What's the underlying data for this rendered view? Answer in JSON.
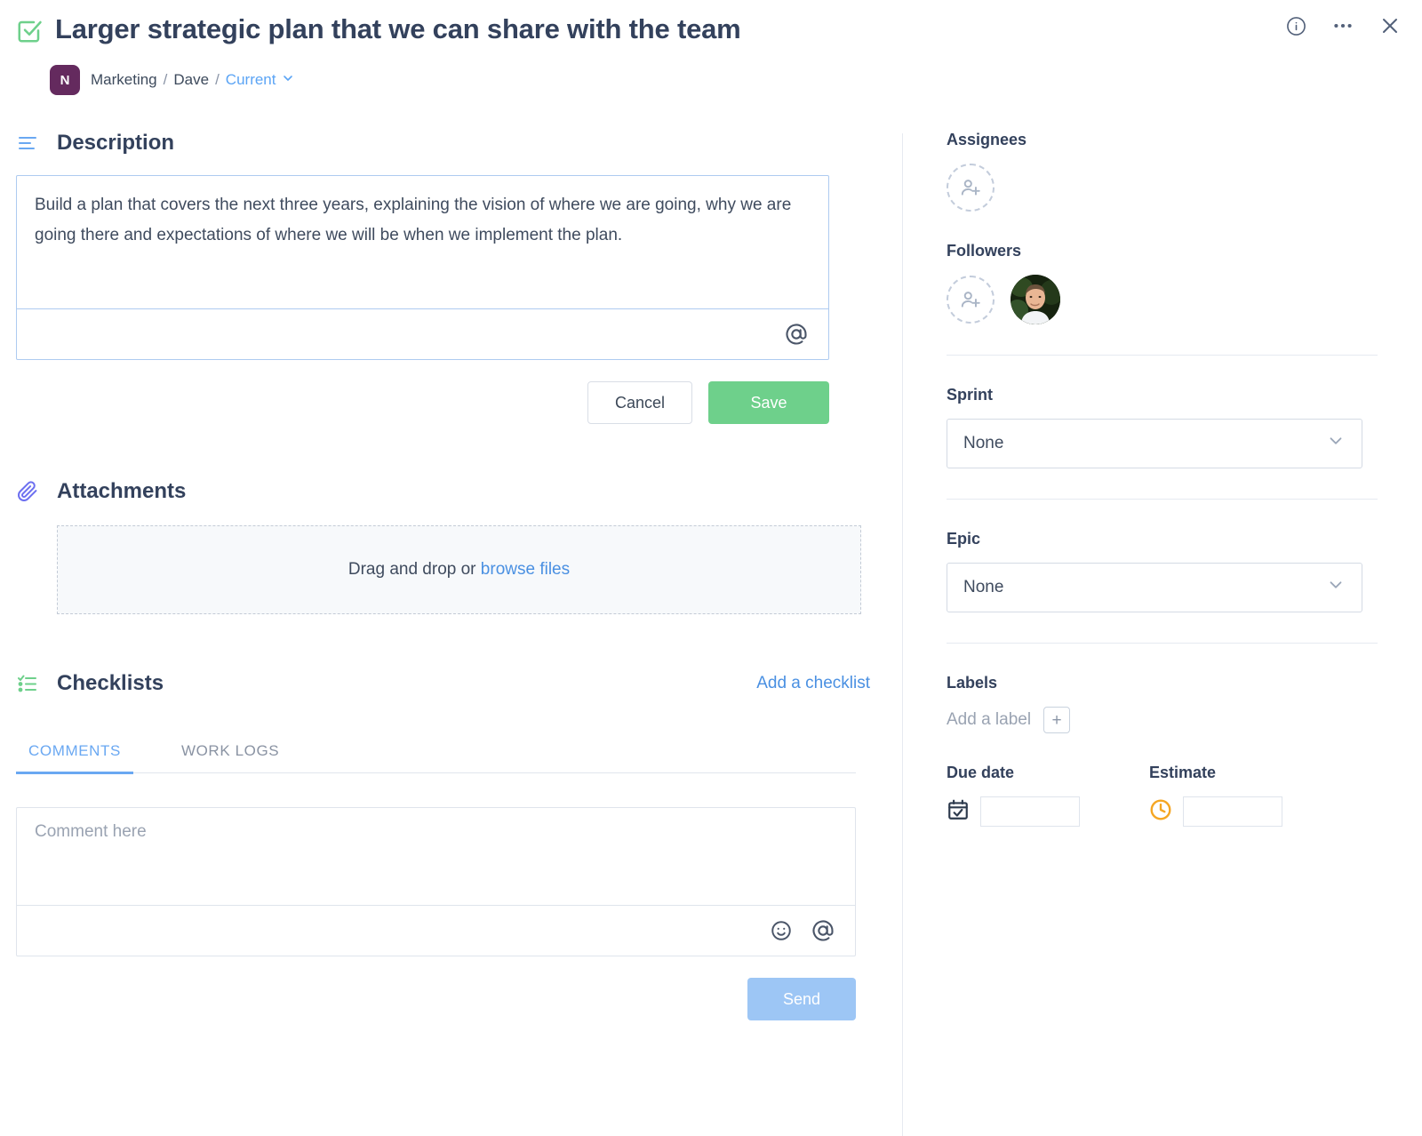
{
  "header": {
    "title": "Larger strategic plan that we can share with the team",
    "status_icon": "checkbox-checked-icon",
    "avatar_initial": "N",
    "breadcrumb": {
      "workspace": "Marketing",
      "board": "Dave",
      "current": "Current",
      "separator": "/"
    },
    "actions": {
      "info": "info-icon",
      "more": "more-options-icon",
      "close": "close-icon"
    }
  },
  "description": {
    "heading": "Description",
    "text": "Build a plan that covers the next three years, explaining the vision of where we are going, why we are going there and expectations of where we will be when we implement the plan.",
    "mention_icon": "@",
    "cancel_label": "Cancel",
    "save_label": "Save"
  },
  "attachments": {
    "heading": "Attachments",
    "dropzone_text": "Drag and drop or",
    "browse_link": "browse files"
  },
  "checklists": {
    "heading": "Checklists",
    "add_link": "Add a checklist"
  },
  "tabs": [
    {
      "label": "COMMENTS",
      "active": true
    },
    {
      "label": "WORK LOGS",
      "active": false
    }
  ],
  "comment": {
    "placeholder": "Comment here",
    "emoji_icon": "emoji-icon",
    "mention_icon": "@",
    "send_label": "Send"
  },
  "sidebar": {
    "assignees": {
      "label": "Assignees",
      "add_tooltip": "add-assignee"
    },
    "followers": {
      "label": "Followers",
      "add_tooltip": "add-follower",
      "avatar_count": 1
    },
    "sprint": {
      "label": "Sprint",
      "value": "None"
    },
    "epic": {
      "label": "Epic",
      "value": "None"
    },
    "labels": {
      "label": "Labels",
      "add_text": "Add a label",
      "plus": "+"
    },
    "due_date": {
      "label": "Due date",
      "value": ""
    },
    "estimate": {
      "label": "Estimate",
      "value": ""
    }
  },
  "colors": {
    "accent_blue": "#4a90e2",
    "save_green": "#6ed08b",
    "send_blue": "#9dc6f5",
    "avatar_purple": "#642a5e",
    "title_navy": "#33415c",
    "estimate_orange": "#f5a623"
  }
}
